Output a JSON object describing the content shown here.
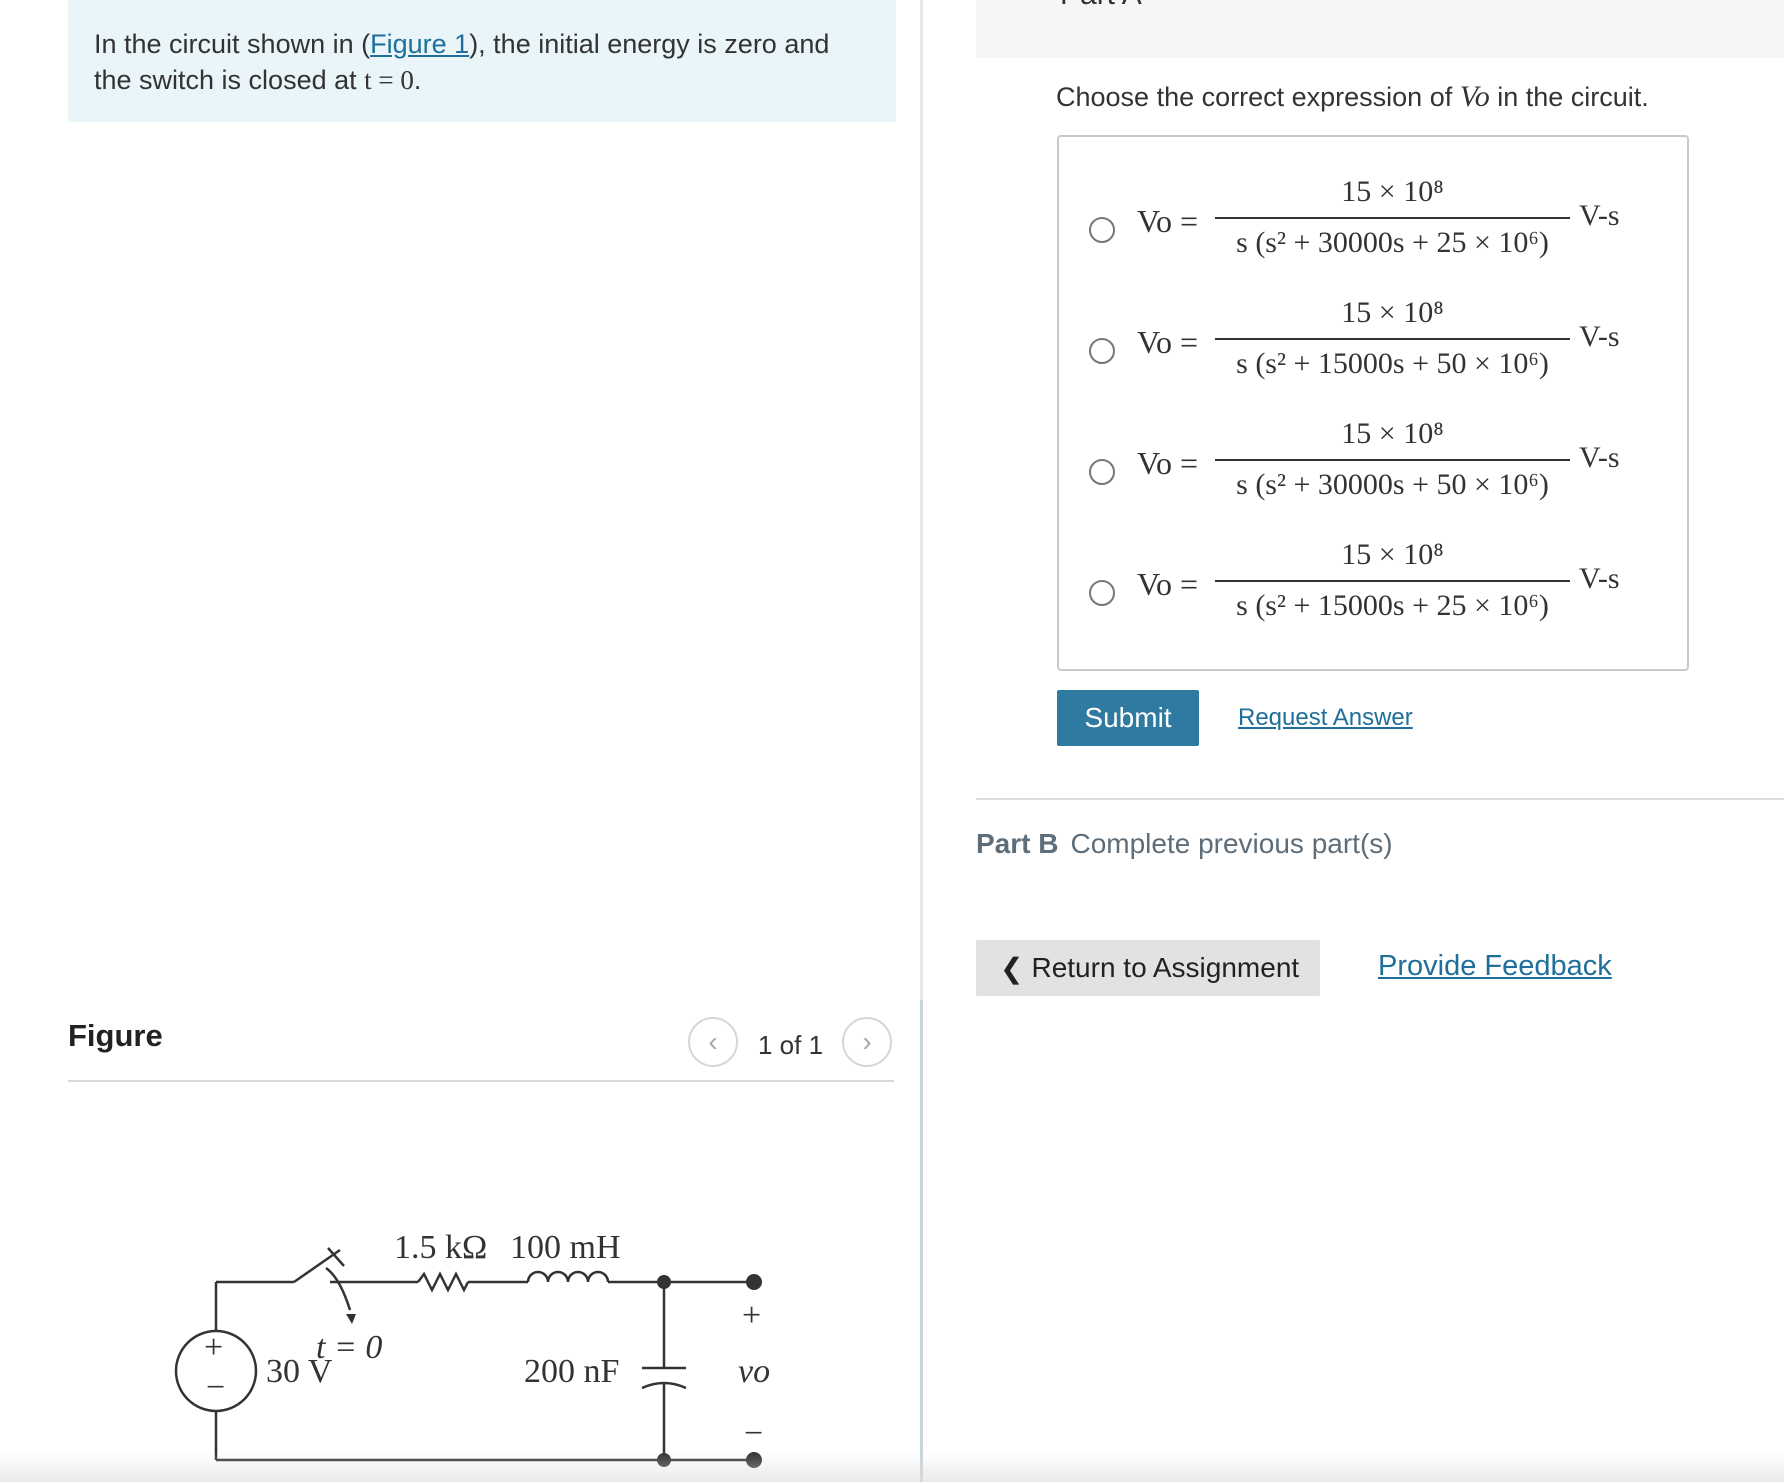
{
  "intro": {
    "text_before_link": "In the circuit shown in (",
    "link": "Figure 1",
    "text_after_link": "), the initial energy is zero and",
    "line2_prefix": "the switch is closed at ",
    "line2_math": "t = 0",
    "line2_suffix": "."
  },
  "figure": {
    "title": "Figure",
    "pager": "1 of 1",
    "prev_icon": "chevron-left-icon",
    "next_icon": "chevron-right-icon"
  },
  "circuit": {
    "source_voltage": "30 V",
    "switch_label": "t = 0",
    "resistor": "1.5 kΩ",
    "inductor": "100 mH",
    "capacitor": "200 nF",
    "output_label": "vo",
    "plus": "+",
    "minus": "−"
  },
  "part_a": {
    "header": "Part A",
    "question_prefix": "Choose the correct expression of ",
    "question_var": "Vo",
    "question_suffix": " in the circuit.",
    "choices": [
      {
        "lhs": "Vo =",
        "numerator": "15 × 10⁸",
        "denominator": "s (s² + 30000s + 25 × 10⁶)",
        "unit": "V-s"
      },
      {
        "lhs": "Vo =",
        "numerator": "15 × 10⁸",
        "denominator": "s (s² + 15000s + 50 × 10⁶)",
        "unit": "V-s"
      },
      {
        "lhs": "Vo =",
        "numerator": "15 × 10⁸",
        "denominator": "s (s² + 30000s + 50 × 10⁶)",
        "unit": "V-s"
      },
      {
        "lhs": "Vo =",
        "numerator": "15 × 10⁸",
        "denominator": "s (s² + 15000s + 25 × 10⁶)",
        "unit": "V-s"
      }
    ],
    "submit_label": "Submit",
    "request_answer_label": "Request Answer"
  },
  "part_b": {
    "label": "Part B",
    "status": "Complete previous part(s)"
  },
  "footer": {
    "return_label": "Return to Assignment",
    "feedback_label": "Provide Feedback"
  },
  "colors": {
    "intro_bg": "#e9f5f8",
    "link": "#1f6f9a",
    "submit_bg": "#2e7aa0",
    "return_bg": "#e2e2e2"
  }
}
